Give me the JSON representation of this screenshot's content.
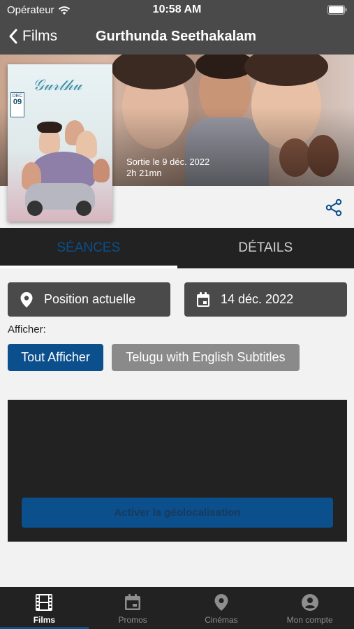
{
  "status_bar": {
    "carrier": "Opérateur",
    "time": "10:58 AM"
  },
  "nav": {
    "back_label": "Films",
    "title": "Gurthunda Seethakalam"
  },
  "movie": {
    "release": "Sortie le 9 déc. 2022",
    "duration": "2h 21mn"
  },
  "tabs": [
    {
      "label": "SÉANCES",
      "active": true
    },
    {
      "label": "DÉTAILS",
      "active": false
    }
  ],
  "filters": {
    "location": "Position actuelle",
    "date": "14 déc. 2022"
  },
  "show": {
    "label": "Afficher:",
    "chips": [
      "Tout Afficher",
      "Telugu with English Subtitles"
    ]
  },
  "geo": {
    "button": "Activer la géolocalisation"
  },
  "tabbar": [
    {
      "label": "Films",
      "icon": "film-icon",
      "active": true
    },
    {
      "label": "Promos",
      "icon": "calendar-icon",
      "active": false
    },
    {
      "label": "Cinémas",
      "icon": "location-pin-icon",
      "active": false
    },
    {
      "label": "Mon compte",
      "icon": "account-icon",
      "active": false
    }
  ],
  "colors": {
    "accent": "#0b4f8c",
    "bar": "#4a4a4a",
    "dark": "#222222"
  }
}
